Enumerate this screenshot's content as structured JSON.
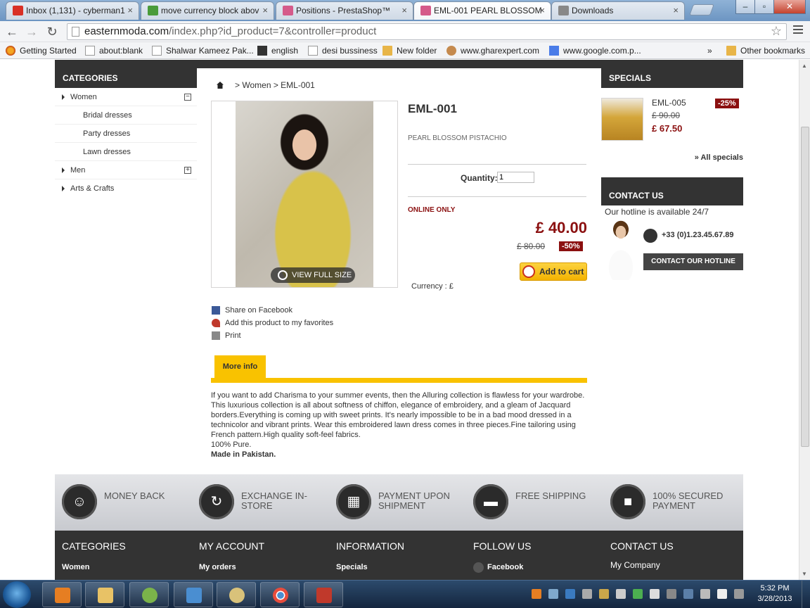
{
  "browser": {
    "tabs": [
      {
        "label": "Inbox (1,131) - cyberman1",
        "icon_color": "#d93025"
      },
      {
        "label": "move currency block abov",
        "icon_color": "#4a9b3a"
      },
      {
        "label": "Positions - PrestaShop™",
        "icon_color": "#d55a8a"
      },
      {
        "label": "EML-001 PEARL BLOSSOM",
        "icon_color": "#d55a8a"
      },
      {
        "label": "Downloads",
        "icon_color": "#888888"
      }
    ],
    "url_host": "easternmoda.com",
    "url_path": "/index.php?id_product=7&controller=product",
    "window_controls": [
      "–",
      "▫",
      "✕"
    ]
  },
  "bookmarks": [
    {
      "label": "Getting Started",
      "icon": "firefox-icon"
    },
    {
      "label": "about:blank",
      "icon": "page-icon"
    },
    {
      "label": "Shalwar Kameez Pak...",
      "icon": "page-icon"
    },
    {
      "label": "english",
      "icon": "page-icon"
    },
    {
      "label": "desi bussiness",
      "icon": "page-icon"
    },
    {
      "label": "New folder",
      "icon": "folder-icon"
    },
    {
      "label": "www.gharexpert.com",
      "icon": "page-icon"
    },
    {
      "label": "www.google.com.p...",
      "icon": "google-icon"
    },
    {
      "label": "»",
      "icon": ""
    },
    {
      "label": "Other bookmarks",
      "icon": "folder-icon"
    }
  ],
  "left": {
    "title": "CATEGORIES",
    "items": [
      {
        "label": "Women",
        "sub": false,
        "toggle": "−"
      },
      {
        "label": "Bridal dresses",
        "sub": true
      },
      {
        "label": "Party dresses",
        "sub": true
      },
      {
        "label": "Lawn dresses",
        "sub": true
      },
      {
        "label": "Men",
        "sub": false,
        "toggle": "+"
      },
      {
        "label": "Arts & Crafts",
        "sub": false
      }
    ]
  },
  "product": {
    "breadcrumb_sep": ">",
    "breadcrumb": "Women > EML-001",
    "view_full": "VIEW FULL SIZE",
    "title": "EML-001",
    "short_desc": "PEARL BLOSSOM PISTACHIO",
    "qty_label": "Quantity:",
    "qty_value": "1",
    "online_only": "ONLINE ONLY",
    "price": "£ 40.00",
    "old_price": "£ 80.00",
    "reduction": "-50%",
    "add_to_cart": "Add to cart",
    "currency": "Currency : £",
    "actions": [
      "Share on Facebook",
      "Add this product to my favorites",
      "Print"
    ],
    "more_info_tab": "More info",
    "long_desc": [
      "If you want to add Charisma to your summer events, then the Alluring collection is flawless for your wardrobe.  This luxurious collection is all about softness of chiffon, elegance of embroidery, and a gleam of Jacquard borders.Everything is coming up with sweet prints. It's nearly impossible to be in a bad mood dressed in a technicolor and vibrant prints. Wear this embroidered lawn dress comes in three pieces.Fine tailoring using French pattern.High quality soft-feel fabrics.",
      "100% Pure."
    ],
    "made_in": "Made in Pakistan."
  },
  "right": {
    "specials_title": "SPECIALS",
    "special": {
      "name": "EML-005",
      "old_price": "£ 90.00",
      "new_price": "£ 67.50",
      "reduction": "-25%"
    },
    "all_specials": "» All specials",
    "contact_title": "CONTACT US",
    "hotline_text": "Our hotline is available 24/7",
    "phone": "+33 (0)1.23.45.67.89",
    "hotline_button": "CONTACT OUR HOTLINE"
  },
  "reassurance": [
    {
      "label": "MONEY BACK",
      "icon": "smile-icon",
      "glyph": "☺"
    },
    {
      "label": "EXCHANGE IN-STORE",
      "icon": "refresh-icon",
      "glyph": "↻"
    },
    {
      "label": "PAYMENT UPON SHIPMENT",
      "icon": "payment-icon",
      "glyph": "▦"
    },
    {
      "label": "FREE SHIPPING",
      "icon": "truck-icon",
      "glyph": "▬"
    },
    {
      "label": "100% SECURED PAYMENT",
      "icon": "lock-icon",
      "glyph": "■"
    }
  ],
  "footer": [
    {
      "heading": "CATEGORIES",
      "link": "Women"
    },
    {
      "heading": "MY ACCOUNT",
      "link": "My orders"
    },
    {
      "heading": "INFORMATION",
      "link": "Specials"
    },
    {
      "heading": "FOLLOW US",
      "link": "Facebook"
    },
    {
      "heading": "CONTACT US",
      "link": "My Company"
    }
  ],
  "taskbar": {
    "time": "5:32 PM",
    "date": "3/28/2013",
    "apps": [
      "media-player-icon",
      "file-explorer-icon",
      "network-icon",
      "control-panel-icon",
      "paint-icon",
      "chrome-icon",
      "filezilla-icon"
    ]
  }
}
